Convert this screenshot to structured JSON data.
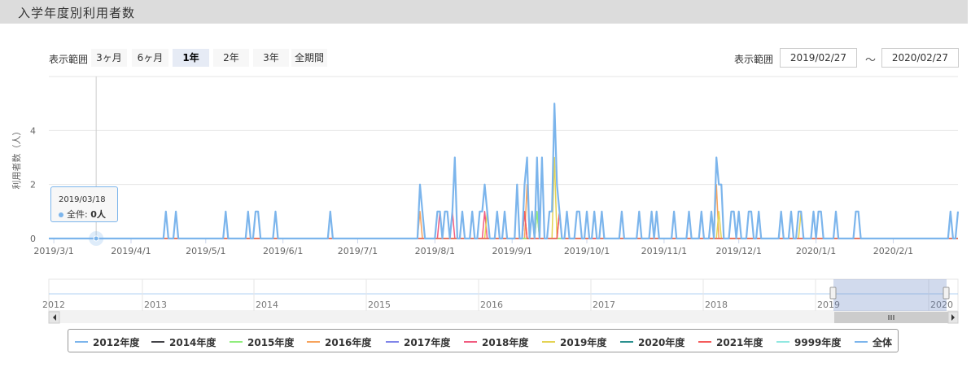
{
  "title": "入学年度別利用者数",
  "range_bar": {
    "label": "表示範囲",
    "buttons": [
      "3ヶ月",
      "6ヶ月",
      "1年",
      "2年",
      "3年",
      "全期間"
    ],
    "selected": "1年"
  },
  "date_range": {
    "label": "表示範囲",
    "from": "2019/02/27",
    "separator": "〜",
    "to": "2020/02/27"
  },
  "tooltip": {
    "date": "2019/03/18",
    "series": "全件",
    "value": "0人"
  },
  "navigator": {
    "years": [
      "2012",
      "2013",
      "2014",
      "2015",
      "2016",
      "2017",
      "2018",
      "2019",
      "2020"
    ]
  },
  "legend": [
    {
      "name": "2012年度",
      "color": "#7cb5ec"
    },
    {
      "name": "2014年度",
      "color": "#434348"
    },
    {
      "name": "2015年度",
      "color": "#90ed7d"
    },
    {
      "name": "2016年度",
      "color": "#f7a35c"
    },
    {
      "name": "2017年度",
      "color": "#8085e9"
    },
    {
      "name": "2018年度",
      "color": "#f15c80"
    },
    {
      "name": "2019年度",
      "color": "#e4d354"
    },
    {
      "name": "2020年度",
      "color": "#2b908f"
    },
    {
      "name": "2021年度",
      "color": "#f45b5b"
    },
    {
      "name": "9999年度",
      "color": "#91e8e1"
    },
    {
      "name": "全体",
      "color": "#7cb5ec"
    }
  ],
  "chart_data": {
    "type": "line",
    "ylabel": "利用者数（人）",
    "xlabel": "",
    "ylim": [
      0,
      6
    ],
    "yticks": [
      0,
      2,
      4
    ],
    "x_tick_labels": [
      "2019/3/1",
      "2019/4/1",
      "2019/5/1",
      "2019/6/1",
      "2019/7/1",
      "2019/8/1",
      "2019/9/1",
      "2019/10/1",
      "2019/11/1",
      "2019/12/1",
      "2020/1/1",
      "2020/2/1"
    ],
    "x_range": [
      "2019-02-27",
      "2020-02-27"
    ],
    "grid": true,
    "legend_position": "bottom",
    "series": [
      {
        "name": "全体",
        "color": "#7cb5ec",
        "points": [
          [
            "2019-04-15",
            1
          ],
          [
            "2019-04-19",
            1
          ],
          [
            "2019-05-09",
            1
          ],
          [
            "2019-05-18",
            1
          ],
          [
            "2019-05-21",
            1
          ],
          [
            "2019-05-22",
            1
          ],
          [
            "2019-05-29",
            1
          ],
          [
            "2019-06-20",
            1
          ],
          [
            "2019-07-26",
            2
          ],
          [
            "2019-07-27",
            1
          ],
          [
            "2019-08-02",
            1
          ],
          [
            "2019-08-03",
            1
          ],
          [
            "2019-08-05",
            1
          ],
          [
            "2019-08-06",
            1
          ],
          [
            "2019-08-08",
            1
          ],
          [
            "2019-08-09",
            3
          ],
          [
            "2019-08-12",
            1
          ],
          [
            "2019-08-16",
            1
          ],
          [
            "2019-08-19",
            1
          ],
          [
            "2019-08-20",
            1
          ],
          [
            "2019-08-21",
            2
          ],
          [
            "2019-08-22",
            1
          ],
          [
            "2019-08-26",
            1
          ],
          [
            "2019-08-29",
            1
          ],
          [
            "2019-09-03",
            2
          ],
          [
            "2019-09-06",
            2
          ],
          [
            "2019-09-07",
            3
          ],
          [
            "2019-09-09",
            1
          ],
          [
            "2019-09-11",
            3
          ],
          [
            "2019-09-13",
            3
          ],
          [
            "2019-09-16",
            1
          ],
          [
            "2019-09-17",
            1
          ],
          [
            "2019-09-18",
            5
          ],
          [
            "2019-09-19",
            2
          ],
          [
            "2019-09-20",
            1
          ],
          [
            "2019-09-23",
            1
          ],
          [
            "2019-09-27",
            1
          ],
          [
            "2019-09-28",
            1
          ],
          [
            "2019-10-01",
            1
          ],
          [
            "2019-10-04",
            1
          ],
          [
            "2019-10-07",
            1
          ],
          [
            "2019-10-15",
            1
          ],
          [
            "2019-10-22",
            1
          ],
          [
            "2019-10-27",
            1
          ],
          [
            "2019-10-29",
            1
          ],
          [
            "2019-11-05",
            1
          ],
          [
            "2019-11-11",
            1
          ],
          [
            "2019-11-16",
            1
          ],
          [
            "2019-11-20",
            1
          ],
          [
            "2019-11-22",
            3
          ],
          [
            "2019-11-23",
            2
          ],
          [
            "2019-11-24",
            2
          ],
          [
            "2019-11-28",
            1
          ],
          [
            "2019-11-29",
            1
          ],
          [
            "2019-12-01",
            1
          ],
          [
            "2019-12-05",
            1
          ],
          [
            "2019-12-06",
            1
          ],
          [
            "2019-12-09",
            1
          ],
          [
            "2019-12-18",
            1
          ],
          [
            "2019-12-22",
            1
          ],
          [
            "2019-12-25",
            1
          ],
          [
            "2019-12-26",
            1
          ],
          [
            "2019-12-31",
            1
          ],
          [
            "2020-01-02",
            1
          ],
          [
            "2020-01-03",
            1
          ],
          [
            "2020-01-09",
            1
          ],
          [
            "2020-01-17",
            1
          ],
          [
            "2020-01-18",
            1
          ],
          [
            "2020-02-24",
            1
          ],
          [
            "2020-02-27",
            1
          ]
        ]
      },
      {
        "name": "2016年度",
        "color": "#f7a35c",
        "points": [
          [
            "2019-07-26",
            1
          ],
          [
            "2019-09-07",
            2
          ],
          [
            "2019-09-11",
            1
          ],
          [
            "2019-11-22",
            2
          ]
        ]
      },
      {
        "name": "2018年度",
        "color": "#f15c80",
        "points": [
          [
            "2019-08-03",
            1
          ],
          [
            "2019-08-08",
            1
          ],
          [
            "2019-08-21",
            1
          ],
          [
            "2019-09-06",
            1
          ],
          [
            "2019-09-20",
            1
          ]
        ]
      },
      {
        "name": "2019年度",
        "color": "#e4d354",
        "points": [
          [
            "2019-08-22",
            1
          ],
          [
            "2019-09-09",
            1
          ],
          [
            "2019-09-18",
            3
          ],
          [
            "2019-10-04",
            1
          ],
          [
            "2019-11-23",
            1
          ],
          [
            "2019-12-26",
            1
          ]
        ]
      },
      {
        "name": "2015年度",
        "color": "#90ed7d",
        "points": [
          [
            "2019-09-11",
            1
          ],
          [
            "2019-10-04",
            1
          ]
        ]
      },
      {
        "name": "2021年度",
        "color": "#f45b5b",
        "points": [
          [
            "2019-09-06",
            1
          ],
          [
            "2019-09-20",
            1
          ]
        ]
      }
    ]
  }
}
